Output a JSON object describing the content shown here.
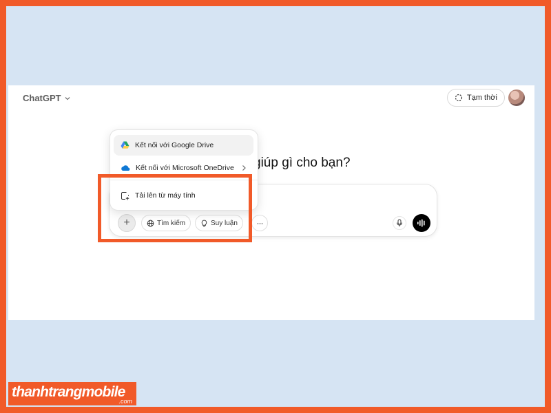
{
  "header": {
    "app_title": "ChatGPT",
    "temp_chat_label": "Tạm thời"
  },
  "main": {
    "heading_partial": "giúp gì cho bạn?"
  },
  "composer": {
    "plus_label": "+",
    "tools": [
      {
        "label": "Tìm kiếm",
        "icon": "globe-icon"
      },
      {
        "label": "Suy luận",
        "icon": "lightbulb-icon"
      }
    ],
    "more_label": "···"
  },
  "menu": {
    "items": [
      {
        "label": "Kết nối với Google Drive",
        "icon": "google-drive-icon"
      },
      {
        "label": "Kết nối với Microsoft OneDrive",
        "icon": "onedrive-icon"
      },
      {
        "label": "Tải lên từ máy tính",
        "icon": "upload-file-icon"
      }
    ]
  },
  "watermark": {
    "main": "thanhtrangmobile",
    "sub": ".com"
  },
  "colors": {
    "frame": "#f15a29",
    "backdrop": "#d6e4f3",
    "highlight": "#f15a29"
  }
}
